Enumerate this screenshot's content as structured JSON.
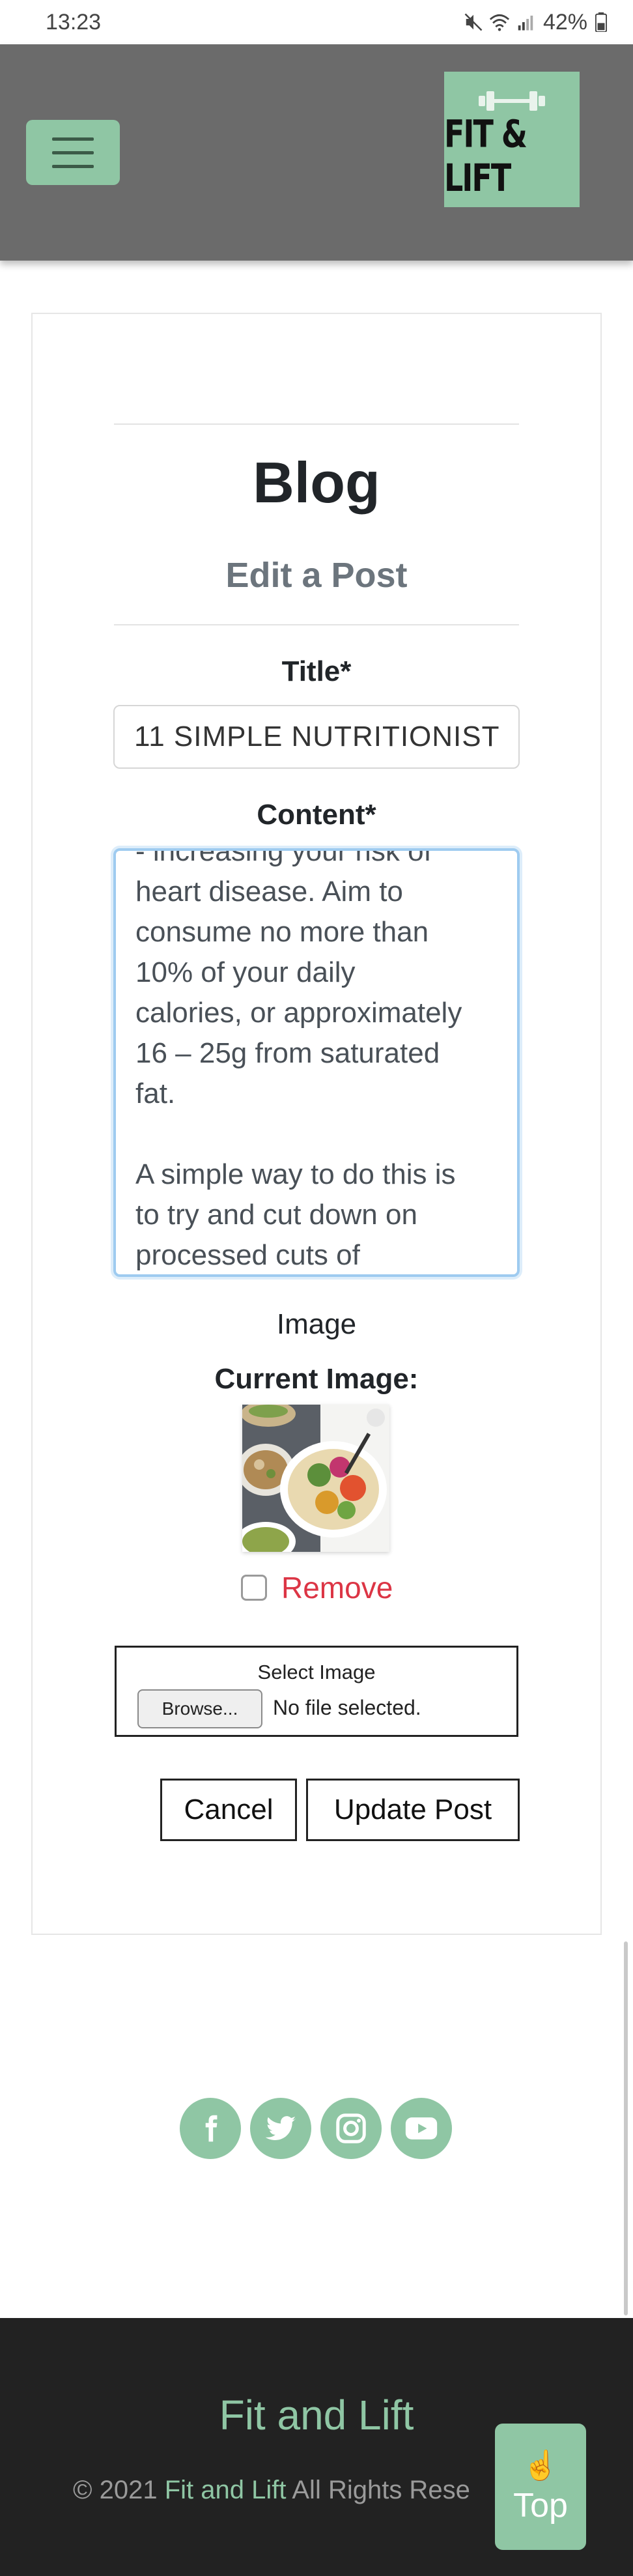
{
  "status_bar": {
    "time": "13:23",
    "battery": "42%"
  },
  "navbar": {
    "menu_icon": "hamburger-icon",
    "logo_text": "FIT & LIFT",
    "logo_icon": "dumbbell-icon"
  },
  "page": {
    "heading": "Blog",
    "subheading": "Edit a Post"
  },
  "form": {
    "title_label": "Title*",
    "title_value": "11 SIMPLE NUTRITIONIST",
    "content_label": "Content*",
    "content_value": "- increasing your risk of\nheart disease. Aim to\nconsume no more than\n10% of your daily\ncalories, or approximately\n16 – 25g from saturated\nfat.\n\nA simple way to do this is\nto try and cut down on\nprocessed cuts of",
    "image_label": "Image",
    "current_image_label": "Current Image:",
    "remove_label": "Remove",
    "select_image_label": "Select Image",
    "browse_label": "Browse...",
    "file_status": "No file selected.",
    "cancel_label": "Cancel",
    "update_label": "Update Post"
  },
  "social": {
    "facebook": "facebook-icon",
    "twitter": "twitter-icon",
    "instagram": "instagram-icon",
    "youtube": "youtube-icon"
  },
  "footer": {
    "brand": "Fit and Lift",
    "copyright_prefix": "© 2021",
    "copyright_brand": "Fit and Lift",
    "copyright_suffix": "All Rights Rese",
    "top_hand": "☝️",
    "top_label": "Top"
  },
  "colors": {
    "accent": "#8fc6a4",
    "navbar": "#6b6b6b",
    "footer": "#222222",
    "danger": "#dc3545",
    "muted": "#6c757d"
  }
}
